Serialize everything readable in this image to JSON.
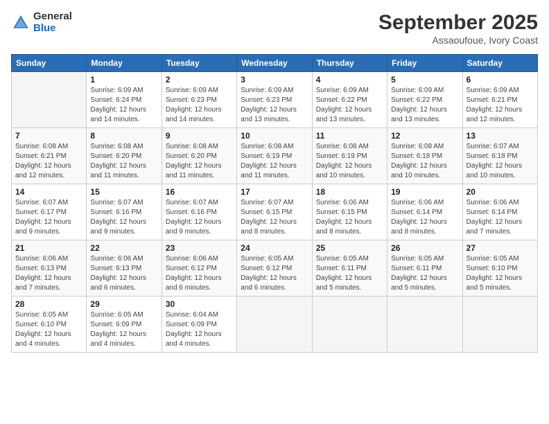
{
  "logo": {
    "line1": "General",
    "line2": "Blue"
  },
  "title": "September 2025",
  "subtitle": "Assaoufoue, Ivory Coast",
  "weekdays": [
    "Sunday",
    "Monday",
    "Tuesday",
    "Wednesday",
    "Thursday",
    "Friday",
    "Saturday"
  ],
  "weeks": [
    [
      {
        "day": "",
        "info": ""
      },
      {
        "day": "1",
        "info": "Sunrise: 6:09 AM\nSunset: 6:24 PM\nDaylight: 12 hours\nand 14 minutes."
      },
      {
        "day": "2",
        "info": "Sunrise: 6:09 AM\nSunset: 6:23 PM\nDaylight: 12 hours\nand 14 minutes."
      },
      {
        "day": "3",
        "info": "Sunrise: 6:09 AM\nSunset: 6:23 PM\nDaylight: 12 hours\nand 13 minutes."
      },
      {
        "day": "4",
        "info": "Sunrise: 6:09 AM\nSunset: 6:22 PM\nDaylight: 12 hours\nand 13 minutes."
      },
      {
        "day": "5",
        "info": "Sunrise: 6:09 AM\nSunset: 6:22 PM\nDaylight: 12 hours\nand 13 minutes."
      },
      {
        "day": "6",
        "info": "Sunrise: 6:09 AM\nSunset: 6:21 PM\nDaylight: 12 hours\nand 12 minutes."
      }
    ],
    [
      {
        "day": "7",
        "info": "Sunrise: 6:08 AM\nSunset: 6:21 PM\nDaylight: 12 hours\nand 12 minutes."
      },
      {
        "day": "8",
        "info": "Sunrise: 6:08 AM\nSunset: 6:20 PM\nDaylight: 12 hours\nand 11 minutes."
      },
      {
        "day": "9",
        "info": "Sunrise: 6:08 AM\nSunset: 6:20 PM\nDaylight: 12 hours\nand 11 minutes."
      },
      {
        "day": "10",
        "info": "Sunrise: 6:08 AM\nSunset: 6:19 PM\nDaylight: 12 hours\nand 11 minutes."
      },
      {
        "day": "11",
        "info": "Sunrise: 6:08 AM\nSunset: 6:19 PM\nDaylight: 12 hours\nand 10 minutes."
      },
      {
        "day": "12",
        "info": "Sunrise: 6:08 AM\nSunset: 6:18 PM\nDaylight: 12 hours\nand 10 minutes."
      },
      {
        "day": "13",
        "info": "Sunrise: 6:07 AM\nSunset: 6:18 PM\nDaylight: 12 hours\nand 10 minutes."
      }
    ],
    [
      {
        "day": "14",
        "info": "Sunrise: 6:07 AM\nSunset: 6:17 PM\nDaylight: 12 hours\nand 9 minutes."
      },
      {
        "day": "15",
        "info": "Sunrise: 6:07 AM\nSunset: 6:16 PM\nDaylight: 12 hours\nand 9 minutes."
      },
      {
        "day": "16",
        "info": "Sunrise: 6:07 AM\nSunset: 6:16 PM\nDaylight: 12 hours\nand 9 minutes."
      },
      {
        "day": "17",
        "info": "Sunrise: 6:07 AM\nSunset: 6:15 PM\nDaylight: 12 hours\nand 8 minutes."
      },
      {
        "day": "18",
        "info": "Sunrise: 6:06 AM\nSunset: 6:15 PM\nDaylight: 12 hours\nand 8 minutes."
      },
      {
        "day": "19",
        "info": "Sunrise: 6:06 AM\nSunset: 6:14 PM\nDaylight: 12 hours\nand 8 minutes."
      },
      {
        "day": "20",
        "info": "Sunrise: 6:06 AM\nSunset: 6:14 PM\nDaylight: 12 hours\nand 7 minutes."
      }
    ],
    [
      {
        "day": "21",
        "info": "Sunrise: 6:06 AM\nSunset: 6:13 PM\nDaylight: 12 hours\nand 7 minutes."
      },
      {
        "day": "22",
        "info": "Sunrise: 6:06 AM\nSunset: 6:13 PM\nDaylight: 12 hours\nand 6 minutes."
      },
      {
        "day": "23",
        "info": "Sunrise: 6:06 AM\nSunset: 6:12 PM\nDaylight: 12 hours\nand 6 minutes."
      },
      {
        "day": "24",
        "info": "Sunrise: 6:05 AM\nSunset: 6:12 PM\nDaylight: 12 hours\nand 6 minutes."
      },
      {
        "day": "25",
        "info": "Sunrise: 6:05 AM\nSunset: 6:11 PM\nDaylight: 12 hours\nand 5 minutes."
      },
      {
        "day": "26",
        "info": "Sunrise: 6:05 AM\nSunset: 6:11 PM\nDaylight: 12 hours\nand 5 minutes."
      },
      {
        "day": "27",
        "info": "Sunrise: 6:05 AM\nSunset: 6:10 PM\nDaylight: 12 hours\nand 5 minutes."
      }
    ],
    [
      {
        "day": "28",
        "info": "Sunrise: 6:05 AM\nSunset: 6:10 PM\nDaylight: 12 hours\nand 4 minutes."
      },
      {
        "day": "29",
        "info": "Sunrise: 6:05 AM\nSunset: 6:09 PM\nDaylight: 12 hours\nand 4 minutes."
      },
      {
        "day": "30",
        "info": "Sunrise: 6:04 AM\nSunset: 6:09 PM\nDaylight: 12 hours\nand 4 minutes."
      },
      {
        "day": "",
        "info": ""
      },
      {
        "day": "",
        "info": ""
      },
      {
        "day": "",
        "info": ""
      },
      {
        "day": "",
        "info": ""
      }
    ]
  ]
}
